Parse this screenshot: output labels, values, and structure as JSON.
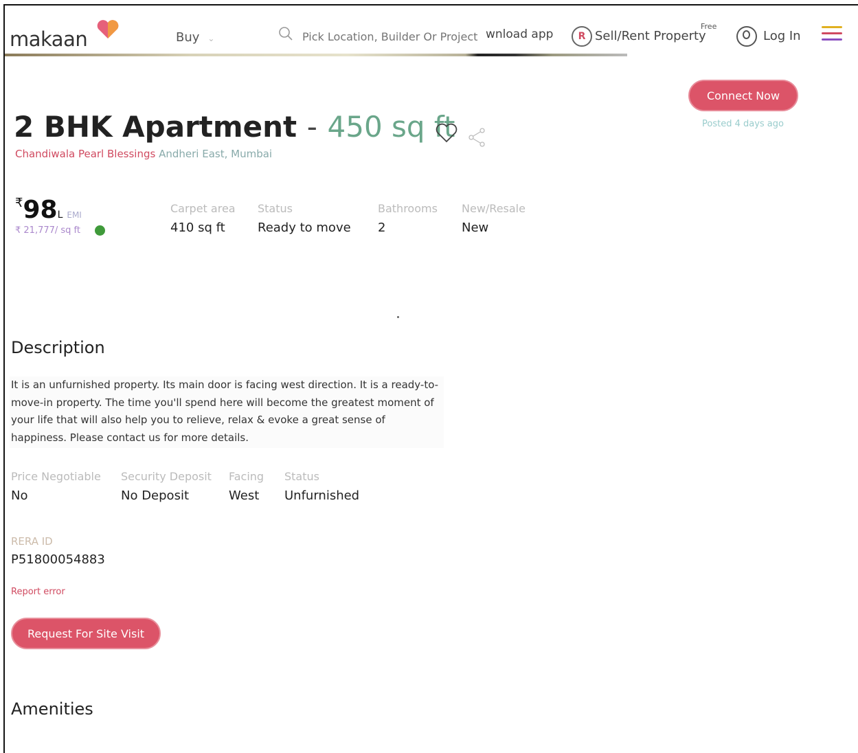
{
  "header": {
    "logo_text": "makaan",
    "nav_buy": "Buy",
    "search_placeholder": "Pick Location, Builder Or Project",
    "download_app": "wnload app",
    "sell_label": "Sell/Rent Property",
    "sell_badge": "Free",
    "login_label": "Log In",
    "menu_colors": [
      "#e0b020",
      "#d04a60",
      "#8a4fc0"
    ]
  },
  "cta": {
    "connect_label": "Connect Now",
    "posted": "Posted 4 days ago"
  },
  "listing": {
    "title": "2 BHK Apartment",
    "separator": "-",
    "size": "450 sq ft",
    "project": "Chandiwala Pearl Blessings",
    "locality": "Andheri East,",
    "city": "Mumbai",
    "price_symbol": "₹",
    "price_value": "98",
    "price_unit": "L",
    "emi_label": "EMI",
    "price_per_sqft": "₹ 21,777/ sq ft",
    "stats": [
      {
        "key": "Carpet area",
        "value": "410 sq ft"
      },
      {
        "key": "Status",
        "value": "Ready to move"
      },
      {
        "key": "Bathrooms",
        "value": "2"
      },
      {
        "key": "New/Resale",
        "value": "New"
      }
    ]
  },
  "description": {
    "heading": "Description",
    "text": "It is an unfurnished property. Its main door is facing west direction. It is a ready-to-move-in property. The time you'll spend here will become the greatest moment of your life that will also help you to relieve, relax & evoke a great sense of happiness. Please contact us for more details.",
    "details": [
      {
        "key": "Price Negotiable",
        "value": "No"
      },
      {
        "key": "Security Deposit",
        "value": "No Deposit"
      },
      {
        "key": "Facing",
        "value": "West"
      },
      {
        "key": "Status",
        "value": "Unfurnished"
      }
    ],
    "rera_label": "RERA ID",
    "rera_value": "P51800054883",
    "report_error": "Report error",
    "site_visit_label": "Request For Site Visit"
  },
  "amenities": {
    "heading": "Amenities"
  },
  "colors": {
    "accent": "#dc5468",
    "area_green": "#6aa68a",
    "verified_green": "#3f9a3a"
  }
}
